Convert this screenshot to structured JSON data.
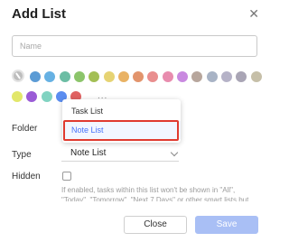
{
  "dialog": {
    "title": "Add List",
    "close_icon": "close-icon"
  },
  "name_input": {
    "value": "",
    "placeholder": "Name"
  },
  "colors": {
    "none_icon": "no-color-icon",
    "swatches": [
      "#5b9bd5",
      "#66b1e3",
      "#6cbda4",
      "#8cc56b",
      "#a3bf55",
      "#e6d373",
      "#e9b264",
      "#e2946c",
      "#e98e8e",
      "#e88cae",
      "#c989e0",
      "#b7a69c",
      "#a8b3c5",
      "#b5b2c7",
      "#a9a5b5",
      "#c6bfa8",
      "#e2e76a",
      "#9a5bd6",
      "#81d3c1",
      "#5a8df0",
      "#e06262"
    ],
    "more_label": "..."
  },
  "folder": {
    "label": "Folder"
  },
  "type": {
    "label": "Type",
    "value": "Note List",
    "options": [
      "Task List",
      "Note List"
    ]
  },
  "hidden": {
    "label": "Hidden",
    "checked": false,
    "hint": "If enabled, tasks within this list won't be shown in \"All\", \"Today\", \"Tomorrow\", \"Next 7 Days\" or other smart lists but"
  },
  "buttons": {
    "close": "Close",
    "save": "Save"
  },
  "theme": {
    "accent": "#4772fa",
    "save_disabled_bg": "#a9bff5",
    "highlight": "#e03a2f"
  }
}
